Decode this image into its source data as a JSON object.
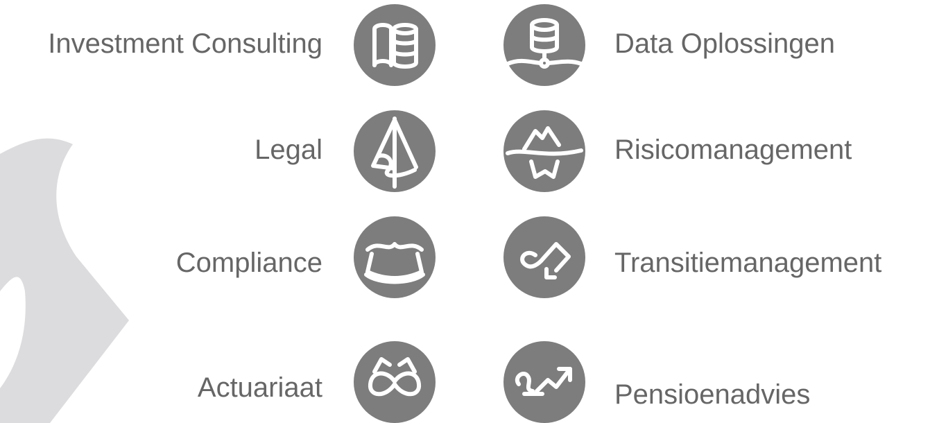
{
  "services": {
    "left": [
      {
        "label": "Investment Consulting",
        "icon": "books-icon"
      },
      {
        "label": "Legal",
        "icon": "sail-icon"
      },
      {
        "label": "Compliance",
        "icon": "tub-icon"
      },
      {
        "label": "Actuariaat",
        "icon": "binoculars-icon"
      }
    ],
    "right": [
      {
        "label": "Data Oplossingen",
        "icon": "database-icon"
      },
      {
        "label": "Risicomanagement",
        "icon": "iceberg-icon"
      },
      {
        "label": "Transitiemanagement",
        "icon": "transition-arrow-icon"
      },
      {
        "label": "Pensioenadvies",
        "icon": "growth-arrow-icon"
      }
    ]
  },
  "colors": {
    "icon_background": "#7d7d7d",
    "icon_stroke": "#ffffff",
    "label_text": "#666666",
    "decorative_shape": "#dcdcde"
  }
}
